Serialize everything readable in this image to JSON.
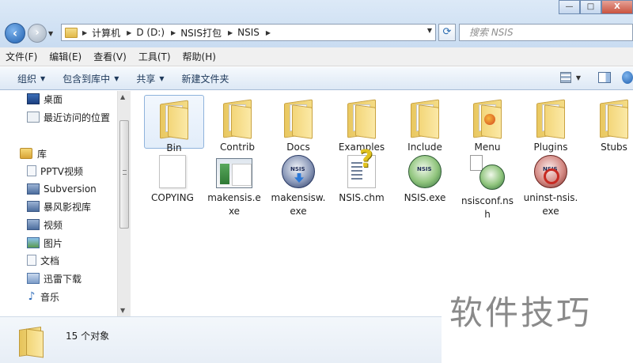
{
  "window": {
    "controls": {
      "minimize": "—",
      "maximize": "□",
      "close": "X"
    }
  },
  "address": {
    "breadcrumbs": [
      "计算机",
      "D (D:)",
      "NSIS打包",
      "NSIS"
    ]
  },
  "search": {
    "placeholder": "搜索 NSIS"
  },
  "menubar": {
    "items": [
      "文件(F)",
      "编辑(E)",
      "查看(V)",
      "工具(T)",
      "帮助(H)"
    ]
  },
  "toolbar": {
    "organize": "组织",
    "include_in_library": "包含到库中",
    "share": "共享",
    "new_folder": "新建文件夹"
  },
  "sidebar": {
    "favorites": [
      {
        "label": "桌面",
        "icon": "desktop-icon"
      },
      {
        "label": "最近访问的位置",
        "icon": "recent-places-icon"
      }
    ],
    "libraries_label": "库",
    "libraries": [
      {
        "label": "PPTV视频",
        "icon": "document-icon"
      },
      {
        "label": "Subversion",
        "icon": "video-icon"
      },
      {
        "label": "暴风影视库",
        "icon": "video-library-icon"
      },
      {
        "label": "视频",
        "icon": "video-icon"
      },
      {
        "label": "图片",
        "icon": "pictures-icon"
      },
      {
        "label": "文档",
        "icon": "documents-icon"
      },
      {
        "label": "迅雷下载",
        "icon": "download-icon"
      },
      {
        "label": "音乐",
        "icon": "music-icon"
      }
    ]
  },
  "files": [
    {
      "label": "Bin",
      "type": "folder"
    },
    {
      "label": "Contrib",
      "type": "folder"
    },
    {
      "label": "Docs",
      "type": "folder"
    },
    {
      "label": "Examples",
      "type": "folder"
    },
    {
      "label": "Include",
      "type": "folder"
    },
    {
      "label": "Menu",
      "type": "folder"
    },
    {
      "label": "Plugins",
      "type": "folder"
    },
    {
      "label": "Stubs",
      "type": "folder"
    },
    {
      "label": "COPYING",
      "type": "file"
    },
    {
      "label": "makensis.exe",
      "type": "exe-window"
    },
    {
      "label": "makensisw.exe",
      "type": "nsis-disc"
    },
    {
      "label": "NSIS.chm",
      "type": "chm"
    },
    {
      "label": "NSIS.exe",
      "type": "nsis-green"
    },
    {
      "label": "nsisconf.nsh",
      "type": "nsh"
    },
    {
      "label": "uninst-nsis.exe",
      "type": "nsis-red"
    }
  ],
  "status": {
    "count": "15 个对象"
  },
  "watermark": "软件技巧"
}
